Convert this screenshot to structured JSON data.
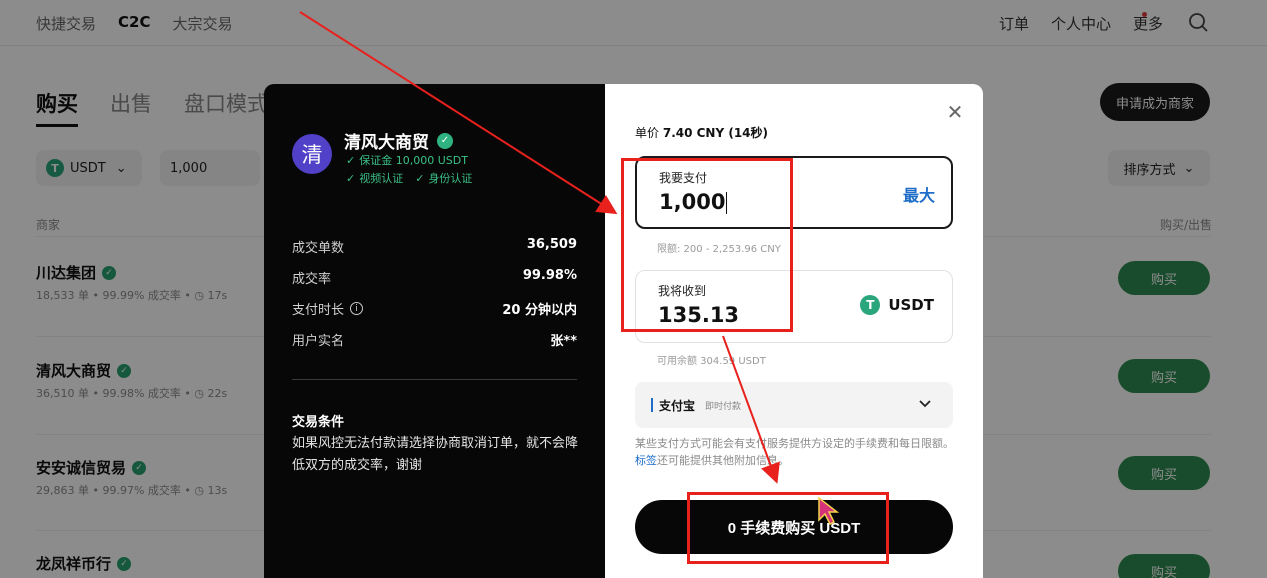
{
  "nav": {
    "left": [
      "快捷交易",
      "C2C",
      "大宗交易"
    ],
    "right": [
      "订单",
      "个人中心",
      "更多"
    ]
  },
  "tabs": [
    "购买",
    "出售",
    "盘口模式"
  ],
  "apply_merchant": "申请成为商家",
  "filters": {
    "coin": "USDT",
    "amount": "1,000",
    "sort": "排序方式"
  },
  "columns": {
    "merchant": "商家",
    "action": "购买/出售"
  },
  "merchants": [
    {
      "name": "川达集团",
      "orders": "18,533 单",
      "rate": "99.99% 成交率",
      "time": "17s",
      "action": "购买"
    },
    {
      "name": "清风大商贸",
      "orders": "36,510 单",
      "rate": "99.98% 成交率",
      "time": "22s",
      "action": "购买"
    },
    {
      "name": "安安诚信贸易",
      "orders": "29,863 单",
      "rate": "99.97% 成交率",
      "time": "13s",
      "action": "购买"
    },
    {
      "name": "龙凤祥币行",
      "orders": "",
      "rate": "",
      "time": "",
      "action": "购买"
    }
  ],
  "modal": {
    "avatar_char": "清",
    "name": "清风大商贸",
    "deposit": "保证金 10,000 USDT",
    "verify_video": "视频认证",
    "verify_id": "身份认证",
    "stats": [
      {
        "k": "成交单数",
        "v": "36,509"
      },
      {
        "k": "成交率",
        "v": "99.98%"
      },
      {
        "k": "支付时长",
        "v": "20 分钟以内"
      },
      {
        "k": "用户实名",
        "v": "张**"
      }
    ],
    "conditions_title": "交易条件",
    "conditions_text": "如果风控无法付款请选择协商取消订单，就不会降低双方的成交率，谢谢",
    "unit_price_label": "单价",
    "unit_price_value": "7.40 CNY (14秒)",
    "pay_label": "我要支付",
    "pay_value": "1,000",
    "max_label": "最大",
    "limit_text": "限额: 200 - 2,253.96 CNY",
    "receive_label": "我将收到",
    "receive_value": "135.13",
    "receive_coin": "USDT",
    "available_text": "可用余额 304.59 USDT",
    "payment_method": "支付宝",
    "payment_sub": "即时付款",
    "note_text": "某些支付方式可能会有支付服务提供方设定的手续费和每日限额。",
    "note_link": "标签",
    "note_tail": "还可能提供其他附加信息。",
    "buy_button": "0 手续费购买 USDT"
  },
  "colors": {
    "accent_green": "#2f8a50",
    "link_blue": "#1e6ec8",
    "annotation_red": "#e8211c"
  }
}
